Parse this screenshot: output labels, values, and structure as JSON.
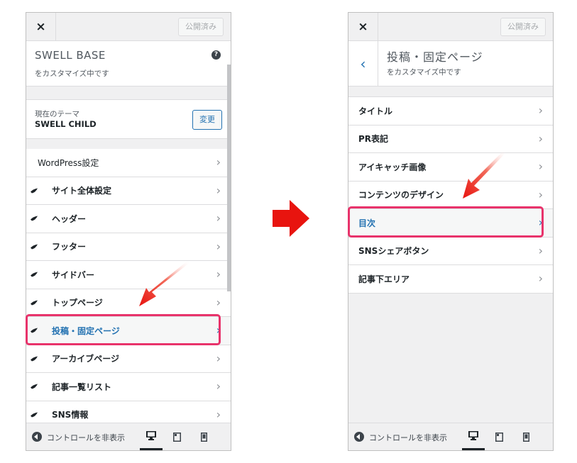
{
  "left": {
    "close_label": "×",
    "publish_label": "公開済み",
    "site_title": "SWELL BASE",
    "customizing": "をカスタマイズ中です",
    "help_label": "?",
    "theme_label": "現在のテーマ",
    "theme_name": "SWELL CHILD",
    "change_label": "変更",
    "menu": [
      {
        "label": "WordPress設定"
      },
      {
        "label": "サイト全体設定"
      },
      {
        "label": "ヘッダー"
      },
      {
        "label": "フッター"
      },
      {
        "label": "サイドバー"
      },
      {
        "label": "トップページ"
      },
      {
        "label": "投稿・固定ページ"
      },
      {
        "label": "アーカイブページ"
      },
      {
        "label": "記事一覧リスト"
      },
      {
        "label": "SNS情報"
      }
    ],
    "collapse_label": "コントロールを非表示"
  },
  "right": {
    "close_label": "×",
    "publish_label": "公開済み",
    "back_label": "‹",
    "section_title": "投稿・固定ページ",
    "customizing": "をカスタマイズ中です",
    "menu": [
      {
        "label": "タイトル"
      },
      {
        "label": "PR表記"
      },
      {
        "label": "アイキャッチ画像"
      },
      {
        "label": "コンテンツのデザイン"
      },
      {
        "label": "目次"
      },
      {
        "label": "SNSシェアボタン"
      },
      {
        "label": "記事下エリア"
      }
    ],
    "collapse_label": "コントロールを非表示"
  },
  "chevron": "›",
  "colors": {
    "accent": "#2271b1",
    "highlight": "#e8336b",
    "arrow": "#e8140f"
  },
  "icons": [
    "close-icon",
    "help-icon",
    "swell-logo-icon",
    "chevron-right-icon",
    "collapse-icon",
    "desktop-icon",
    "tablet-icon",
    "mobile-icon",
    "back-chevron-icon",
    "big-right-arrow-icon",
    "pointer-arrow-icon"
  ]
}
